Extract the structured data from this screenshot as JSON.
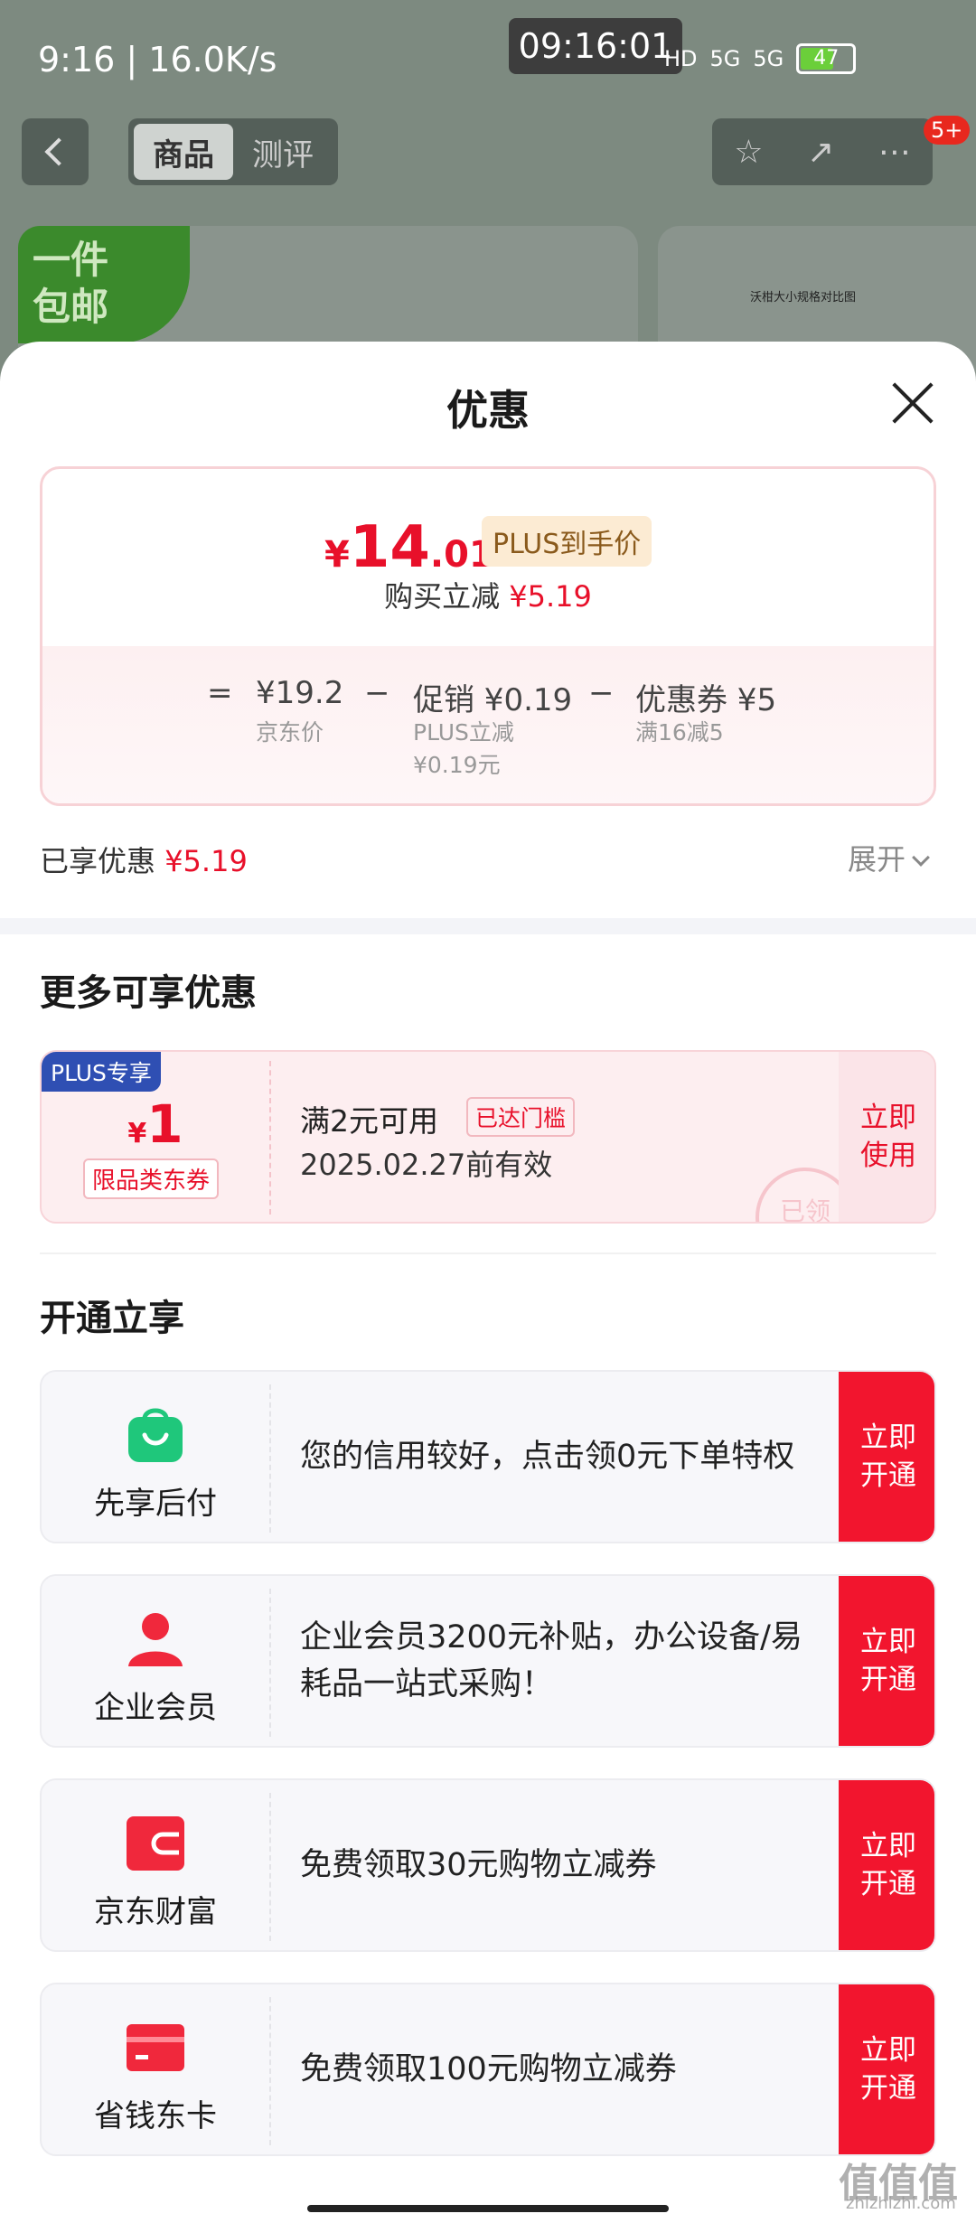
{
  "status": {
    "time": "9:16 | 16.0K/s",
    "clock": "09:16:01",
    "network": "5G",
    "battery": "47"
  },
  "nav": {
    "tab_product": "商品",
    "tab_review": "测评",
    "badge": "5+"
  },
  "bg": {
    "promo_tag": "一件\n包邮",
    "right_card_text": "沃柑大小规格对比图"
  },
  "sheet": {
    "title": "优惠",
    "final_price": {
      "symbol": "¥",
      "integer": "14",
      "decimal": ".01"
    },
    "plus_label": "PLUS到手价",
    "reduce_prefix": "购买立减",
    "reduce_amount": "¥5.19",
    "calc": {
      "eq": "=",
      "jd_price": "¥19.2",
      "jd_label": "京东价",
      "minus1": "−",
      "promo": "促销 ¥0.19",
      "promo_sub": "PLUS立减\n¥0.19元",
      "minus2": "−",
      "coupon": "优惠券 ¥5",
      "coupon_sub": "满16减5"
    },
    "enjoyed_label": "已享优惠",
    "enjoyed_amount": "¥5.19",
    "expand": "展开"
  },
  "more": {
    "title": "更多可享优惠",
    "coupon": {
      "plus_tag": "PLUS专享",
      "symbol": "¥",
      "amount": "1",
      "type": "限品类东券",
      "condition": "满2元可用",
      "reached": "已达门槛",
      "valid": "2025.02.27前有效",
      "stamp": "已领",
      "use": "立即\n使用"
    }
  },
  "open": {
    "title": "开通立享",
    "items": [
      {
        "name": "先享后付",
        "desc": "您的信用较好，点击领0元下单特权",
        "btn": "立即\n开通",
        "icon": "shopping-bag-icon",
        "color": "#1fc77b"
      },
      {
        "name": "企业会员",
        "desc": "企业会员3200元补贴，办公设备/易耗品一站式采购！",
        "btn": "立即\n开通",
        "icon": "person-icon",
        "color": "#f0283c"
      },
      {
        "name": "京东财富",
        "desc": "免费领取30元购物立减券",
        "btn": "立即\n开通",
        "icon": "wallet-icon",
        "color": "#f0283c"
      },
      {
        "name": "省钱东卡",
        "desc": "免费领取100元购物立减券",
        "btn": "立即\n开通",
        "icon": "card-icon",
        "color": "#f0283c"
      }
    ]
  },
  "watermark": {
    "main": "值值值",
    "sub": "zhizhizhi.com"
  }
}
